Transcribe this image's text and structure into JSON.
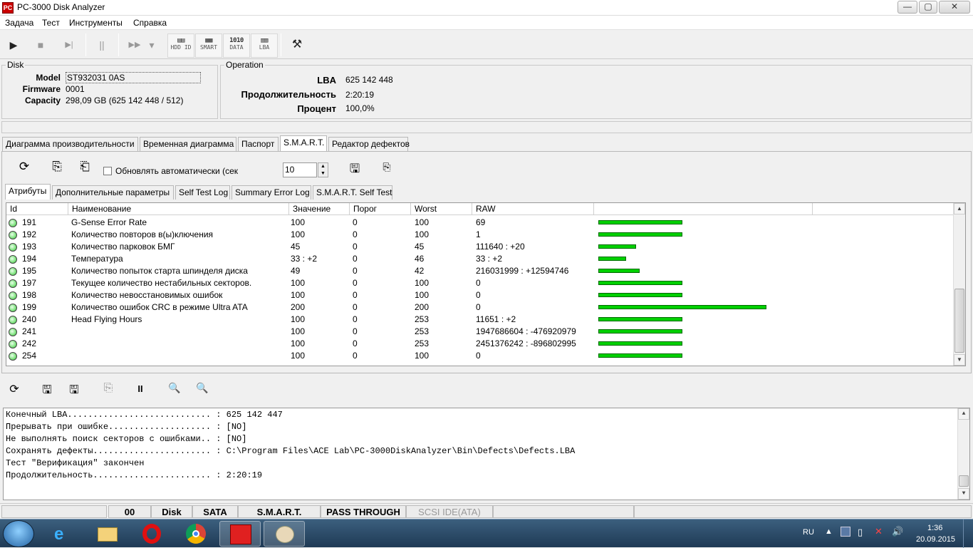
{
  "window": {
    "title": "PC-3000 Disk Analyzer",
    "app_icon": "PC",
    "min": "—",
    "max": "▢",
    "close": "✕"
  },
  "menu": [
    "Задача",
    "Тест",
    "Инструменты",
    "Справка"
  ],
  "toolbar": {
    "play": "▶",
    "stop": "■",
    "step": "▶|",
    "pause": "||",
    "forward": "▶▶",
    "dropdown": "▾",
    "hdd_id": "HDD ID",
    "smart": "SMART",
    "data": "DATA",
    "lba": "LBA",
    "tools": "⚒"
  },
  "disk": {
    "legend": "Disk",
    "model_label": "Model",
    "model": "ST932031 0AS",
    "firmware_label": "Firmware",
    "firmware": "0001",
    "capacity_label": "Capacity",
    "capacity": "298,09 GB (625 142 448 / 512)"
  },
  "operation": {
    "legend": "Operation",
    "lba_label": "LBA",
    "lba": "625 142 448",
    "duration_label": "Продолжительность",
    "duration": "2:20:19",
    "percent_label": "Процент",
    "percent": "100,0%"
  },
  "main_tabs": [
    "Диаграмма производительности",
    "Временная диаграмма",
    "Паспорт",
    "S.M.A.R.T.",
    "Редактор дефектов"
  ],
  "smart_toolbar": {
    "auto_refresh_label": "Обновлять автоматически (сек",
    "interval": "10"
  },
  "sub_tabs": [
    "Атрибуты",
    "Дополнительные параметры",
    "Self Test Log",
    "Summary Error Log",
    "S.M.A.R.T. Self Test"
  ],
  "table": {
    "columns": [
      "Id",
      "Наименование",
      "Значение",
      "Порог",
      "Worst",
      "RAW"
    ],
    "rows": [
      {
        "id": "191",
        "name": "G-Sense Error Rate",
        "value": "100",
        "threshold": "0",
        "worst": "100",
        "raw": "69",
        "bar": 0.5
      },
      {
        "id": "192",
        "name": "Количество повторов в(ы)ключения",
        "value": "100",
        "threshold": "0",
        "worst": "100",
        "raw": "1",
        "bar": 0.5
      },
      {
        "id": "193",
        "name": "Количество парковок БМГ",
        "value": "45",
        "threshold": "0",
        "worst": "45",
        "raw": "111640 : +20",
        "bar": 0.225
      },
      {
        "id": "194",
        "name": "Температура",
        "value": "33 : +2",
        "threshold": "0",
        "worst": "46",
        "raw": "33 : +2",
        "bar": 0.165
      },
      {
        "id": "195",
        "name": "Количество попыток старта шпинделя диска",
        "value": "49",
        "threshold": "0",
        "worst": "42",
        "raw": "216031999 : +12594746",
        "bar": 0.245
      },
      {
        "id": "197",
        "name": "Текущее количество нестабильных секторов.",
        "value": "100",
        "threshold": "0",
        "worst": "100",
        "raw": "0",
        "bar": 0.5
      },
      {
        "id": "198",
        "name": "Количество невосстановимых ошибок",
        "value": "100",
        "threshold": "0",
        "worst": "100",
        "raw": "0",
        "bar": 0.5
      },
      {
        "id": "199",
        "name": "Количество ошибок CRC в режиме Ultra ATA",
        "value": "200",
        "threshold": "0",
        "worst": "200",
        "raw": "0",
        "bar": 1.0
      },
      {
        "id": "240",
        "name": "Head Flying Hours",
        "value": "100",
        "threshold": "0",
        "worst": "253",
        "raw": "11651 : +2",
        "bar": 0.5
      },
      {
        "id": "241",
        "name": "",
        "value": "100",
        "threshold": "0",
        "worst": "253",
        "raw": "1947686604 : -476920979",
        "bar": 0.5
      },
      {
        "id": "242",
        "name": "",
        "value": "100",
        "threshold": "0",
        "worst": "253",
        "raw": "2451376242 : -896802995",
        "bar": 0.5
      },
      {
        "id": "254",
        "name": "",
        "value": "100",
        "threshold": "0",
        "worst": "100",
        "raw": "0",
        "bar": 0.5
      }
    ]
  },
  "log": [
    "Конечный LBA............................ : 625 142 447",
    "Прерывать при ошибке.................... : [NO]",
    "Не выполнять поиск секторов с ошибками.. : [NO]",
    "Сохранять дефекты....................... : C:\\Program Files\\ACE Lab\\PC-3000DiskAnalyzer\\Bin\\Defects\\Defects.LBA",
    "Тест \"Верификация\" закончен",
    "Продолжительность....................... : 2:20:19"
  ],
  "statusbar": [
    "00",
    "Disk",
    "SATA",
    "S.M.A.R.T.",
    "PASS THROUGH",
    "SCSI IDE(ATA)"
  ],
  "tray": {
    "lang": "RU",
    "time": "1:36",
    "date": "20.09.2015"
  },
  "colors": {
    "bar": "#00d000",
    "taskbar": "#2c4a66"
  }
}
